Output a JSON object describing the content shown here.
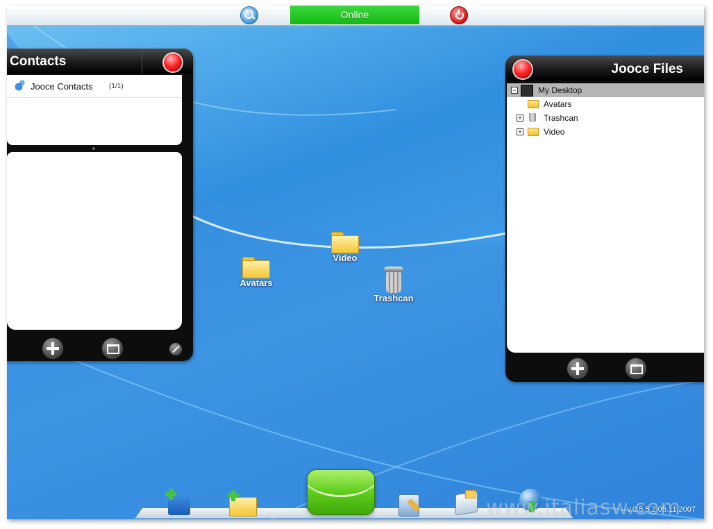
{
  "topbar": {
    "status_label": "Online",
    "search_icon": "search-icon",
    "power_icon": "power-icon"
  },
  "contacts": {
    "title": "Contacts",
    "groups": [
      {
        "label": "Jooce Contacts",
        "count": "(1/1)"
      }
    ]
  },
  "files": {
    "title": "Jooce Files",
    "tree": [
      {
        "label": "My Desktop",
        "toggle": "⊟",
        "icon": "desktop-icon"
      },
      {
        "label": "Avatars",
        "toggle": "",
        "icon": "folder-icon"
      },
      {
        "label": "Trashcan",
        "toggle": "⊞",
        "icon": "trash-icon"
      },
      {
        "label": "Video",
        "toggle": "⊞",
        "icon": "folder-icon"
      }
    ]
  },
  "desktop": {
    "icons": [
      {
        "label": "Avatars",
        "icon": "folder-icon"
      },
      {
        "label": "Video",
        "icon": "folder-icon"
      },
      {
        "label": "Trashcan",
        "icon": "trash-icon"
      }
    ]
  },
  "dock": {
    "items": [
      {
        "icon": "save-icon"
      },
      {
        "icon": "new-folder-icon"
      },
      {
        "icon": "mail-icon"
      },
      {
        "icon": "settings-icon"
      },
      {
        "icon": "mailbox-icon"
      },
      {
        "icon": "globe-icon"
      }
    ]
  },
  "footer": {
    "version": "v.0.5.5.2 05.11.2007",
    "watermark": "www.italiasw.com"
  },
  "colors": {
    "online": "#1fc41f",
    "desktop_blue": "#2f8fe0",
    "panel_black": "#0d0d0d",
    "close_red": "#ff2a2a"
  }
}
